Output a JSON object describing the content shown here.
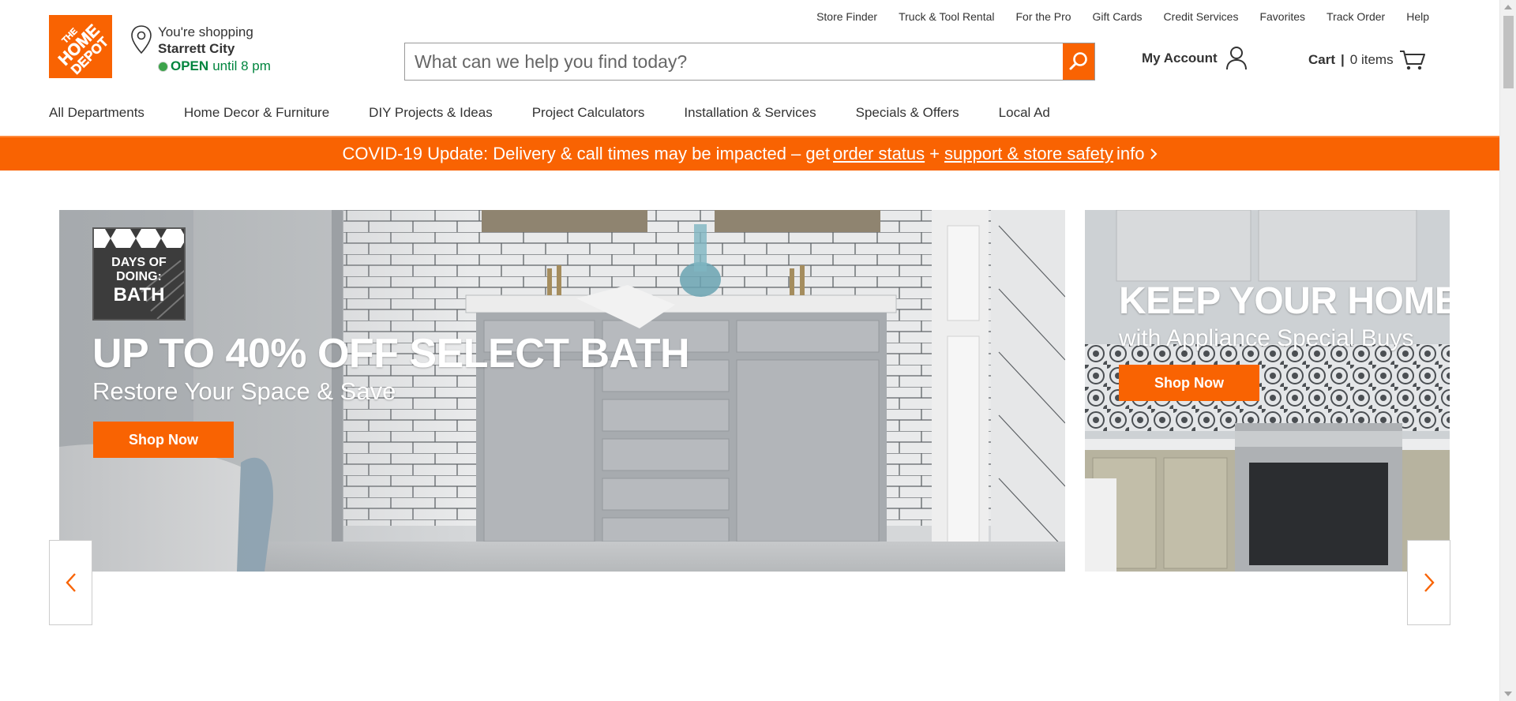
{
  "brand": {
    "logo_text": "THE HOME DEPOT",
    "accent_color": "#f96302",
    "open_color": "#00853e"
  },
  "store": {
    "line1": "You're shopping",
    "store_name": "Starrett City",
    "open_label": "OPEN",
    "hours": "until 8 pm",
    "icon": "location-pin-icon"
  },
  "utility_links": [
    "Store Finder",
    "Truck & Tool Rental",
    "For the Pro",
    "Gift Cards",
    "Credit Services",
    "Favorites",
    "Track Order",
    "Help"
  ],
  "search": {
    "placeholder": "What can we help you find today?",
    "button_icon": "search-icon"
  },
  "account": {
    "label": "My Account",
    "icon": "user-icon"
  },
  "cart": {
    "label": "Cart",
    "separator": "|",
    "items": "0 items",
    "icon": "cart-icon"
  },
  "nav": [
    "All Departments",
    "Home Decor & Furniture",
    "DIY Projects & Ideas",
    "Project Calculators",
    "Installation & Services",
    "Specials & Offers",
    "Local Ad"
  ],
  "covid_banner": {
    "prefix": "COVID-19 Update: Delivery & call times may be impacted – get",
    "link1": "order status",
    "plus": "+",
    "link2": "support & store safety",
    "suffix": "info"
  },
  "hero": {
    "badge_line1": "DAYS OF",
    "badge_line2": "DOING:",
    "badge_line3": "BATH",
    "title": "UP TO 40% OFF SELECT BATH",
    "subtitle": "Restore Your Space & Save",
    "cta": "Shop Now"
  },
  "hero2": {
    "title": "KEEP YOUR HOME R",
    "subtitle": "with Appliance Special Buys",
    "cta": "Shop Now"
  },
  "carousel": {
    "prev_icon": "chevron-left-icon",
    "next_icon": "chevron-right-icon"
  }
}
